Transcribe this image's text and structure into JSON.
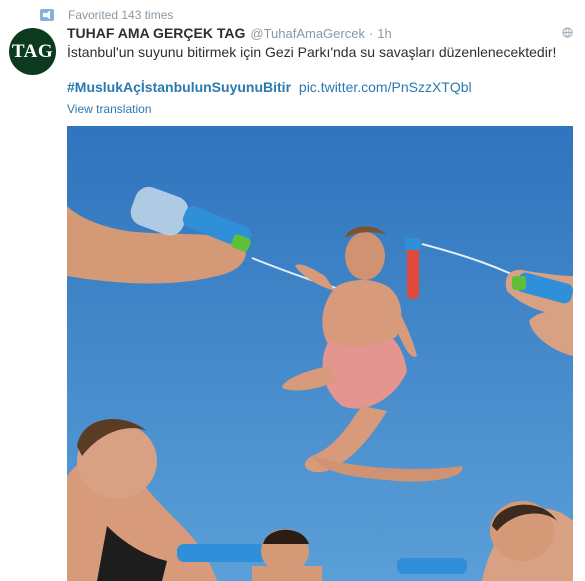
{
  "context": {
    "text": "Favorited 143 times",
    "icon": "favorite-context-icon"
  },
  "tweet": {
    "avatar_text": "TAG",
    "name": "TUHAF AMA GERÇEK TAG",
    "handle": "@TuhafAmaGercek",
    "separator": "·",
    "time": "1h",
    "text": "İstanbul'un suyunu bitirmek için Gezi Parkı'nda su savaşları düzenlenecektedir!",
    "hashtag": "#MuslukAçİstanbulunSuyunuBitir",
    "pic_link": "pic.twitter.com/PnSzzXTQbl",
    "translate": "View translation",
    "globe_icon": "globe-icon"
  },
  "media": {
    "description_icon": "photo",
    "sky_color": "#3f85c9"
  }
}
